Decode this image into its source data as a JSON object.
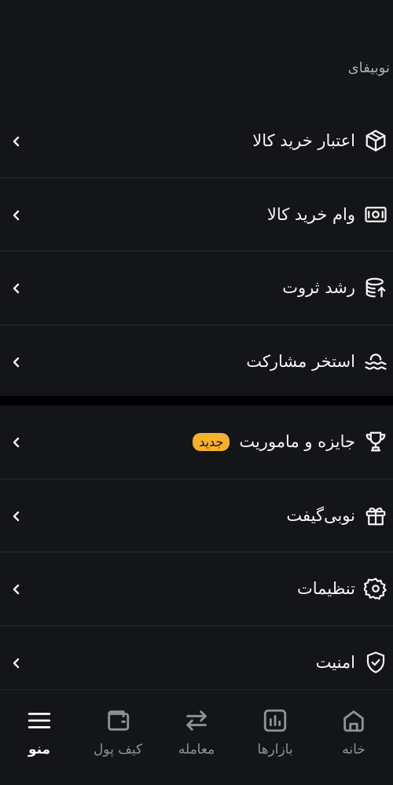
{
  "section_title": "نوبیفای",
  "group1": [
    {
      "label": "اعتبار خرید کالا",
      "icon": "box-icon"
    },
    {
      "label": "وام خرید کالا",
      "icon": "banknote-icon"
    },
    {
      "label": "رشد ثروت",
      "icon": "coins-growth-icon"
    },
    {
      "label": "استخر مشارکت",
      "icon": "pool-waves-icon"
    }
  ],
  "group2": [
    {
      "label": "جایزه و ماموریت",
      "icon": "trophy-icon",
      "badge": "جدید"
    },
    {
      "label": "نوبی‌گیفت",
      "icon": "gift-icon"
    },
    {
      "label": "تنظیمات",
      "icon": "gear-icon"
    },
    {
      "label": "امنیت",
      "icon": "shield-check-icon"
    }
  ],
  "nav": [
    {
      "label": "خانه",
      "icon": "home-icon"
    },
    {
      "label": "بازارها",
      "icon": "chart-icon"
    },
    {
      "label": "معامله",
      "icon": "swap-icon"
    },
    {
      "label": "کیف پول",
      "icon": "wallet-icon"
    },
    {
      "label": "منو",
      "icon": "menu-icon",
      "active": true
    }
  ],
  "colors": {
    "background": "#141518",
    "badge": "#f5b02e",
    "muted": "#8e929b"
  }
}
